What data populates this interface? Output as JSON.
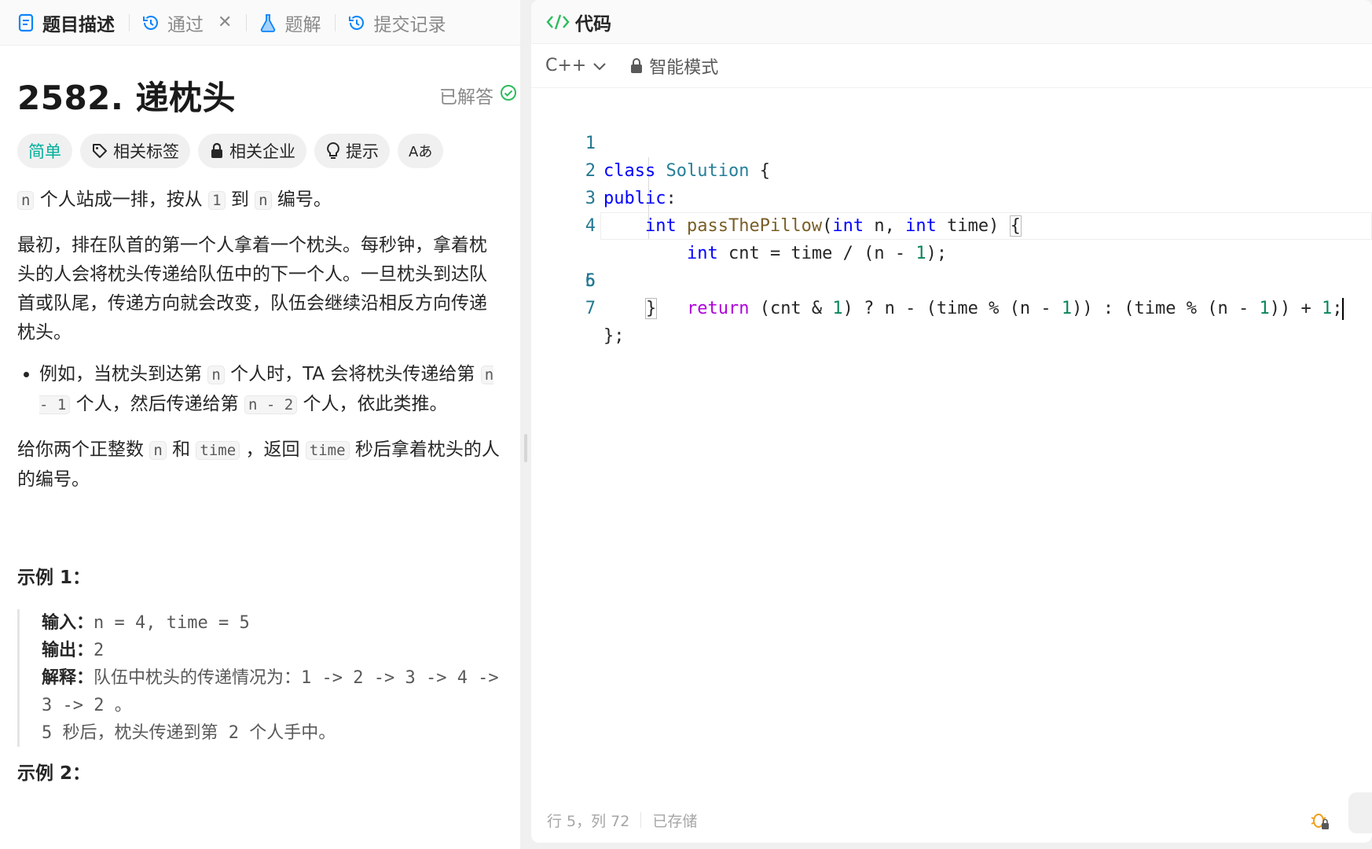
{
  "left_tabs": [
    {
      "label": "题目描述",
      "icon": "document-icon",
      "active": true
    },
    {
      "label": "通过",
      "icon": "history-icon",
      "closable": true
    },
    {
      "label": "题解",
      "icon": "flask-icon"
    },
    {
      "label": "提交记录",
      "icon": "history-icon"
    }
  ],
  "problem": {
    "title": "2582. 递枕头",
    "solved_label": "已解答",
    "tags": {
      "difficulty": "简单",
      "related_tags": "相关标签",
      "related_companies": "相关企业",
      "hint": "提示",
      "font_toggle": "Aあ"
    },
    "para1": {
      "code_n": "n",
      "text1": " 个人站成一排，按从 ",
      "code_1": "1",
      "text2": " 到 ",
      "code_n2": "n",
      "text3": " 编号。"
    },
    "para2": "最初，排在队首的第一个人拿着一个枕头。每秒钟，拿着枕头的人会将枕头传递给队伍中的下一个人。一旦枕头到达队首或队尾，传递方向就会改变，队伍会继续沿相反方向传递枕头。",
    "bullet": {
      "text1": "例如，当枕头到达第 ",
      "code_n": "n",
      "text2": " 个人时，TA 会将枕头传递给第 ",
      "code_a": "n - 1",
      "text3": " 个人，然后传递给第 ",
      "code_b": "n - 2",
      "text4": " 个人，依此类推。"
    },
    "para3": {
      "text1": "给你两个正整数 ",
      "code_n": "n",
      "text2": " 和 ",
      "code_time": "time",
      "text3": " ，返回 ",
      "code_time2": "time",
      "text4": " 秒后拿着枕头的人的编号。"
    },
    "example1": {
      "title": "示例 1：",
      "input_label": "输入：",
      "input": "n = 4, time = 5",
      "output_label": "输出：",
      "output": "2",
      "explain_label": "解释：",
      "explain1": "队伍中枕头的传递情况为：1 -> 2 -> 3 -> 4 -> 3 -> 2 。",
      "explain2": "5 秒后，枕头传递到第 2 个人手中。"
    },
    "example2_title": "示例 2："
  },
  "editor": {
    "header": "代码",
    "language": "C++",
    "mode": "智能模式",
    "line_numbers": [
      "1",
      "2",
      "3",
      "4",
      "5",
      "6",
      "7"
    ],
    "status_position": "行 5，列 72",
    "status_saved": "已存储"
  },
  "colors": {
    "easy": "#00af9b",
    "solved_check": "#2cbb5d",
    "keyword": "#0000ff",
    "return_keyword": "#af00db",
    "function": "#795e26",
    "class": "#267f99",
    "number": "#098658",
    "line_number": "#237893"
  }
}
